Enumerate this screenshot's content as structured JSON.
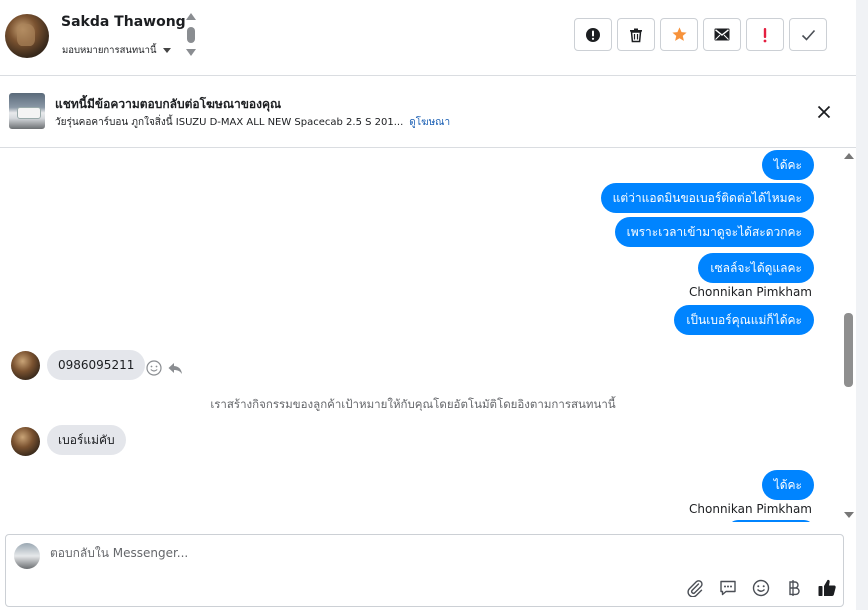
{
  "header": {
    "contact_name": "Sakda Thawong",
    "assign_label": "มอบหมายการสนทนานี้",
    "actions": [
      {
        "name": "mark-spam-button",
        "icon": "exclamation-circle-icon"
      },
      {
        "name": "delete-button",
        "icon": "trash-icon"
      },
      {
        "name": "star-button",
        "icon": "star-icon",
        "color": "#f7923b"
      },
      {
        "name": "mark-unread-button",
        "icon": "envelope-icon"
      },
      {
        "name": "follow-up-button",
        "icon": "exclamation-icon",
        "color": "#e41e3f"
      },
      {
        "name": "mark-done-button",
        "icon": "check-icon"
      }
    ]
  },
  "banner": {
    "title": "แชทนี้มีข้อความตอบกลับต่อโฆษณาของคุณ",
    "subtitle": "วัยรุ่นคอคาร์บอน ภูกใจสิ่งนี้ ISUZU D-MAX ALL NEW Spacecab 2.5 S 201...",
    "link": "ดูโฆษณา"
  },
  "messages": {
    "out1": "ได้คะ",
    "out2": "แต่ว่าแอดมินขอเบอร์ติดต่อได้ไหมคะ",
    "out3": "เพราะเวลาเข้ามาดูจะได้สะดวกคะ",
    "out4": "เซลล์จะได้ดูแลคะ",
    "sender1": "Chonnikan Pimkham",
    "out5": "เป็นเบอร์คุณแม่ก็ได้คะ",
    "in1": "0986095211",
    "system": "เราสร้างกิจกรรมของลูกค้าเป้าหมายให้กับคุณโดยอัตโนมัติโดยอิงตามการสนทนานี้",
    "in2": "เบอร์แม่คับ",
    "out6": "ได้คะ",
    "sender2": "Chonnikan Pimkham"
  },
  "composer": {
    "placeholder": "ตอบกลับใน Messenger...",
    "tools": [
      "paperclip-icon",
      "saved-reply-icon",
      "emoji-icon",
      "baht-icon",
      "thumbs-up-icon"
    ]
  },
  "colors": {
    "accent": "#0084ff",
    "incoming_bubble": "#e4e6eb",
    "link": "#1a5fb4"
  }
}
